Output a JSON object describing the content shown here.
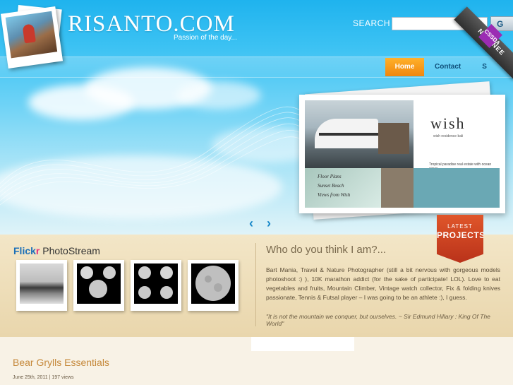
{
  "header": {
    "site_title": "RISANTO.COM",
    "tagline": "Passion of the day...",
    "search_label": "SEARCH",
    "search_value": "",
    "search_button": "G",
    "ribbon_text": "NOMINEE",
    "ribbon_badge": "CSSDA"
  },
  "nav": {
    "items": [
      {
        "label": "Home",
        "active": true
      },
      {
        "label": "Contact",
        "active": false
      },
      {
        "label": "S",
        "active": false
      }
    ]
  },
  "slideshow": {
    "logo": "wish",
    "logo_sub": "wish residence bali",
    "floor_lines": [
      "Floor Plans",
      "Sunset Beach",
      "Views from Wish"
    ],
    "teal_title": "Tropical paradise real estate with ocean views.",
    "prev_icon": "chevron-left-icon",
    "next_icon": "chevron-right-icon"
  },
  "latest": {
    "line1": "LATEST",
    "line2": "PROJECTS"
  },
  "flickr": {
    "brand_a": "Flick",
    "brand_b": "r",
    "label": " PhotoStream",
    "thumbs": [
      "pier-bw",
      "moon-grid",
      "moon-phases",
      "full-moon"
    ]
  },
  "about": {
    "title": "Who do you think I am?...",
    "text": "Bart Mania, Travel & Nature Photographer (still a bit nervous with gorgeous models photoshoot :) ), 10K marathon addict (for the sake of participate! LOL). Love to eat vegetables and fruits, Mountain Climber, Vintage watch collector, Fix & folding knives passionate, Tennis & Futsal player – I was going to be an athlete :), I guess.",
    "quote": "\"It is not the mountain we conquer, but ourselves. ~ Sir Edmund Hillary : King Of The World\""
  },
  "post": {
    "title": "Bear Grylls Essentials",
    "meta": "June 25th, 2011 | 197 views"
  },
  "colors": {
    "sky": "#3cc2f3",
    "nav_active": "#f0860e",
    "flickr_blue": "#1b6fb8",
    "flickr_pink": "#e6307d",
    "badge_red": "#b9321a",
    "post_title": "#c5883a"
  }
}
